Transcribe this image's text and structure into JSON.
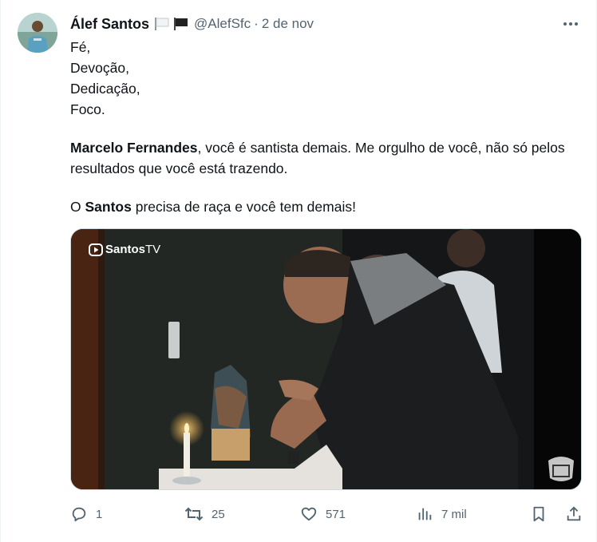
{
  "author": {
    "name": "Álef Santos",
    "handle": "@AlefSfc",
    "separator": "·",
    "date": "2 de nov"
  },
  "flag_icons": [
    "white-flag-icon",
    "black-flag-icon"
  ],
  "tweet": {
    "line1": "Fé,",
    "line2": "Devoção,",
    "line3": "Dedicação,",
    "line4": "Foco.",
    "p2_bold": "Marcelo Fernandes",
    "p2_rest": ", você é santista demais. Me orgulho de você, não só pelos resultados que você está trazendo.",
    "p3_start": "O ",
    "p3_bold": "Santos",
    "p3_rest": " precisa de raça e você tem demais!"
  },
  "media": {
    "watermark_brand": "Santos",
    "watermark_suffix": "TV"
  },
  "actions": {
    "replies": "1",
    "reposts": "25",
    "likes": "571",
    "views": "7 mil"
  },
  "colors": {
    "text": "#0f1419",
    "secondary": "#536471"
  }
}
